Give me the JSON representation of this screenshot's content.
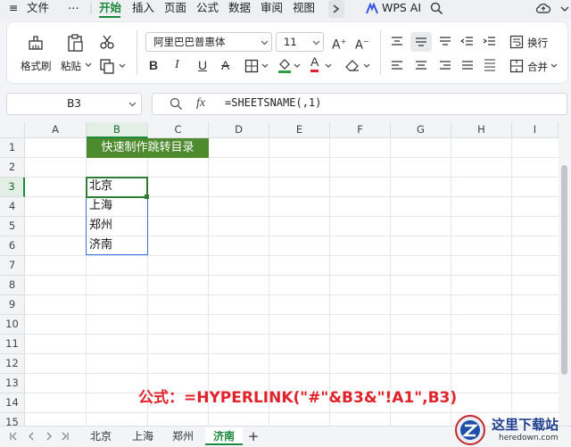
{
  "menubar": {
    "hamburger": "≡",
    "file": "文件",
    "more": "⋯",
    "tabs": [
      "开始",
      "插入",
      "页面",
      "公式",
      "数据",
      "审阅",
      "视图"
    ],
    "wps_ai": "WPS AI"
  },
  "ribbon": {
    "format_painter": "格式刷",
    "paste": "粘贴",
    "font_name": "阿里巴巴普惠体",
    "font_size": "11",
    "bold": "B",
    "italic": "I",
    "underline": "U",
    "strike": "A",
    "font_color": "A",
    "wrap": "换行",
    "merge": "合并"
  },
  "formula_bar": {
    "name_box": "B3",
    "fx": "fx",
    "formula": "=SHEETSNAME(,1)"
  },
  "grid": {
    "columns": [
      "A",
      "B",
      "C",
      "D",
      "E",
      "F",
      "G",
      "H",
      "I"
    ],
    "rows": [
      "1",
      "2",
      "3",
      "4",
      "5",
      "6",
      "7",
      "8",
      "9",
      "10",
      "11",
      "12",
      "13",
      "14",
      "15"
    ],
    "selected_column": "B",
    "selected_row": "3",
    "title_cell": "快速制作跳转目录",
    "values": [
      "北京",
      "上海",
      "郑州",
      "济南"
    ]
  },
  "annotation": "公式：=HYPERLINK(\"#\"&B3&\"!A1\",B3)",
  "sheets": [
    "北京",
    "上海",
    "郑州",
    "济南"
  ],
  "active_sheet": "济南",
  "add_sheet": "+",
  "watermark": {
    "name": "这里下载站",
    "url": "heredown.com"
  },
  "colors": {
    "accent": "#1b8a3b",
    "title_fill": "#4e8a2e",
    "annotation": "#e0232b",
    "range_outline": "#3a6fd8"
  }
}
